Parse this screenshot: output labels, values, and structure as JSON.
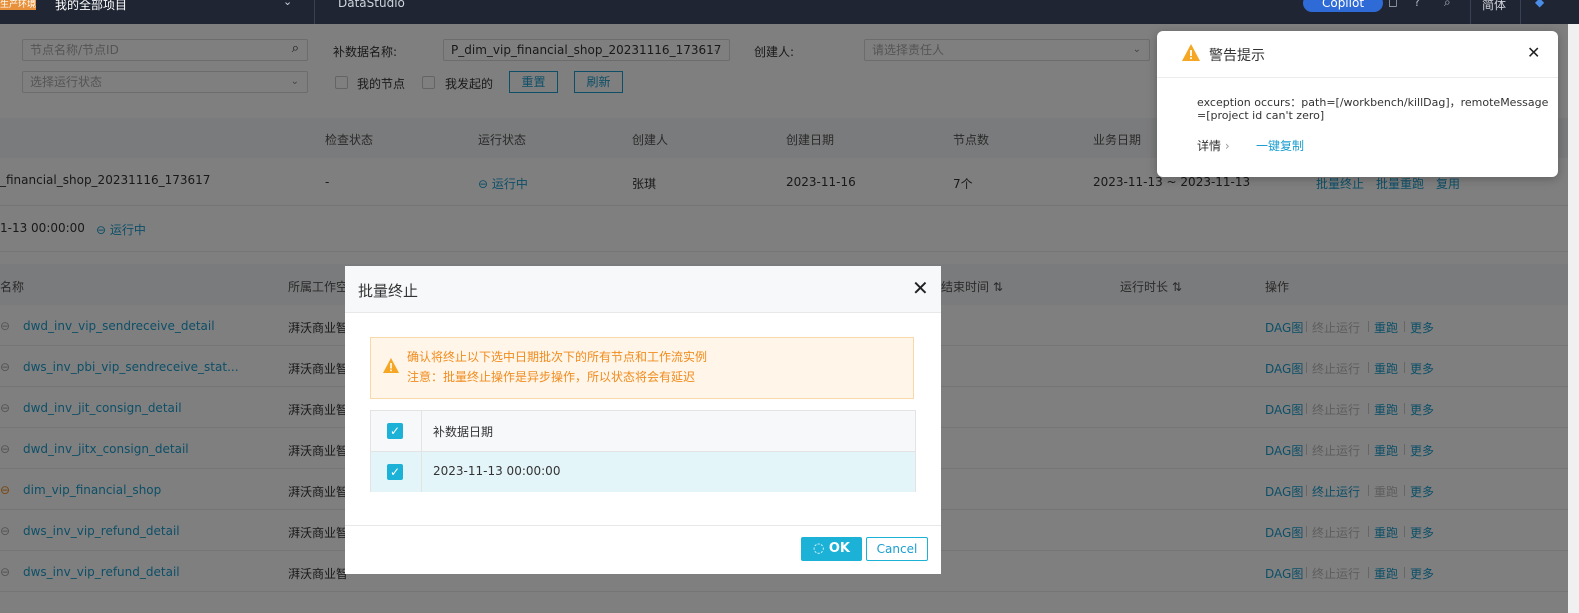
{
  "topbar": {
    "project_badge": "生产环境",
    "project_name": "我的全部项目",
    "product_name": "DataStudio",
    "copilot_label": "Copilot",
    "lang_label": "简体"
  },
  "filters": {
    "node_search_placeholder": "节点名称/节点ID",
    "backfill_name_label": "补数据名称:",
    "backfill_name_value": "P_dim_vip_financial_shop_20231116_173617",
    "creator_label": "创建人:",
    "creator_placeholder": "请选择责任人",
    "run_status_placeholder": "选择运行状态",
    "my_nodes_label": "我的节点",
    "initiated_by_me_label": "我发起的",
    "reset_button": "重置",
    "refresh_button": "刷新"
  },
  "summary_table": {
    "headers": [
      "检查状态",
      "运行状态",
      "创建人",
      "创建日期",
      "节点数",
      "业务日期"
    ],
    "row": {
      "name": "_financial_shop_20231116_173617",
      "check_status": "-",
      "run_status": "运行中",
      "creator": "张琪",
      "create_date": "2023-11-16",
      "node_count": "7个",
      "biz_date": "2023-11-13 ~ 2023-11-13",
      "actions": [
        "批量终止",
        "批量重跑",
        "复用"
      ]
    },
    "subrow": {
      "datetime": "1-13 00:00:00",
      "status": "运行中"
    }
  },
  "nodes_table": {
    "headers": {
      "name": "名称",
      "workspace": "所属工作空",
      "end_time": "结束时间",
      "duration": "运行时长",
      "actions": "操作"
    },
    "rows": [
      {
        "name": "dwd_inv_vip_sendreceive_detail",
        "workspace": "湃沃商业智",
        "actions": [
          "DAG图",
          "终止运行",
          "重跑",
          "更多"
        ]
      },
      {
        "name": "dws_inv_pbi_vip_sendreceive_stat...",
        "workspace": "湃沃商业智",
        "actions": [
          "DAG图",
          "终止运行",
          "重跑",
          "更多"
        ]
      },
      {
        "name": "dwd_inv_jit_consign_detail",
        "workspace": "湃沃商业智",
        "actions": [
          "DAG图",
          "终止运行",
          "重跑",
          "更多"
        ]
      },
      {
        "name": "dwd_inv_jitx_consign_detail",
        "workspace": "湃沃商业智",
        "actions": [
          "DAG图",
          "终止运行",
          "重跑",
          "更多"
        ]
      },
      {
        "name": "dim_vip_financial_shop",
        "workspace": "湃沃商业智",
        "actions": [
          "DAG图",
          "终止运行",
          "重跑",
          "更多"
        ]
      },
      {
        "name": "dws_inv_vip_refund_detail",
        "workspace": "湃沃商业智",
        "actions": [
          "DAG图",
          "终止运行",
          "重跑",
          "更多"
        ]
      },
      {
        "name": "dws_inv_vip_refund_detail",
        "workspace": "湃沃商业智",
        "actions": [
          "DAG图",
          "终止运行",
          "重跑",
          "更多"
        ]
      }
    ]
  },
  "modal": {
    "title": "批量终止",
    "warning_line1": "确认将终止以下选中日期批次下的所有节点和工作流实例",
    "warning_line2": "注意：批量终止操作是异步操作，所以状态将会有延迟",
    "table_header": "补数据日期",
    "table_row": "2023-11-13 00:00:00",
    "ok_label": "OK",
    "cancel_label": "Cancel"
  },
  "notification": {
    "title": "警告提示",
    "message_line1": "exception occurs：path=[/workbench/killDag]，remoteMessage",
    "message_line2": "=[project id can't zero]",
    "detail_label": "详情",
    "copy_label": "一键复制"
  },
  "colors": {
    "accent": "#1cb2d8",
    "warning": "#f08c1e",
    "topbar": "#1f2533"
  }
}
